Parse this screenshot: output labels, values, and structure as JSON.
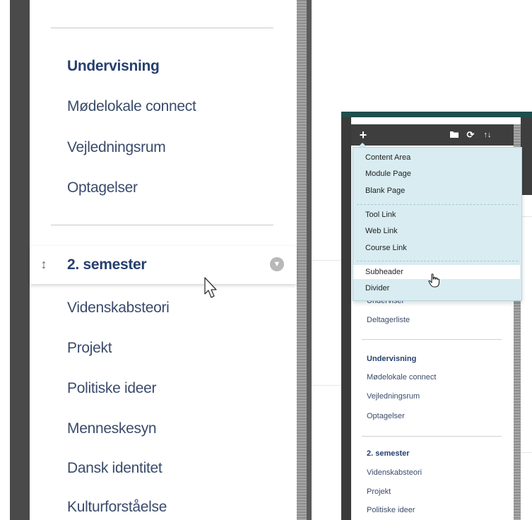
{
  "left_panel": {
    "top_items": [
      "Undervisning",
      "Mødelokale connect",
      "Vejledningsrum",
      "Optagelser"
    ],
    "hovered_item": "2. semester",
    "bottom_items": [
      "Videnskabsteori",
      "Projekt",
      "Politiske ideer",
      "Menneskesyn",
      "Dansk identitet",
      "Kulturforståelse"
    ]
  },
  "right_panel": {
    "toolbar": {
      "add_label": "+",
      "folder_icon": "folder-icon",
      "refresh_icon": "refresh-icon",
      "sort_icon": "sort-icon",
      "refresh_glyph": "⟳",
      "sort_glyph": "↑↓"
    },
    "dropdown": {
      "group1": [
        "Content Area",
        "Module Page",
        "Blank Page"
      ],
      "group2": [
        "Tool Link",
        "Web Link",
        "Course Link"
      ],
      "group3": [
        "Subheader",
        "Divider"
      ],
      "hovered": "Subheader"
    },
    "menu": {
      "partial_item": "Underviser",
      "item_deltagerliste": "Deltagerliste",
      "section1_header": "Undervisning",
      "section1_items": [
        "Mødelokale connect",
        "Vejledningsrum",
        "Optagelser"
      ],
      "section2_header": "2. semester",
      "section2_items": [
        "Videnskabsteori",
        "Projekt",
        "Politiske ideer"
      ]
    }
  },
  "colors": {
    "link_text": "#3a4b6b",
    "header_text": "#27406e",
    "dropdown_bg": "#d8ecf1",
    "topbar": "#1f4e4c"
  }
}
